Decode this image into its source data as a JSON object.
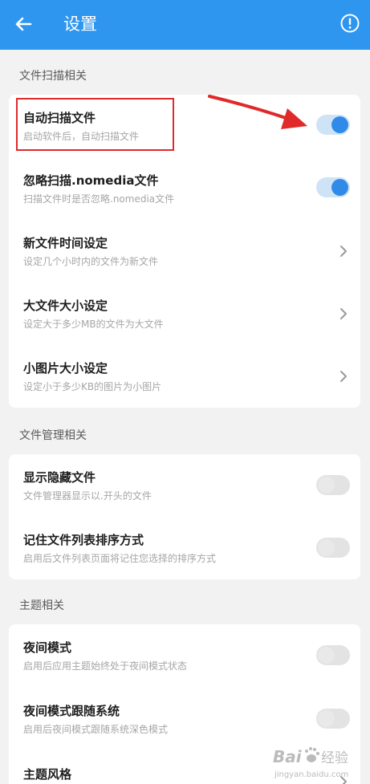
{
  "header": {
    "title": "设置",
    "back_icon": "arrow-left-icon",
    "info_icon": "exclamation-circle-icon"
  },
  "sections": [
    {
      "title": "文件扫描相关",
      "items": [
        {
          "label": "自动扫描文件",
          "sub": "启动软件后，自动扫描文件",
          "control": "toggle",
          "state": "on"
        },
        {
          "label": "忽略扫描.nomedia文件",
          "sub": "扫描文件时是否忽略.nomedia文件",
          "control": "toggle",
          "state": "on"
        },
        {
          "label": "新文件时间设定",
          "sub": "设定几个小时内的文件为新文件",
          "control": "chevron"
        },
        {
          "label": "大文件大小设定",
          "sub": "设定大于多少MB的文件为大文件",
          "control": "chevron"
        },
        {
          "label": "小图片大小设定",
          "sub": "设定小于多少KB的图片为小图片",
          "control": "chevron"
        }
      ]
    },
    {
      "title": "文件管理相关",
      "items": [
        {
          "label": "显示隐藏文件",
          "sub": "文件管理器显示以.开头的文件",
          "control": "toggle",
          "state": "off"
        },
        {
          "label": "记住文件列表排序方式",
          "sub": "启用后文件列表页面将记住您选择的排序方式",
          "control": "toggle",
          "state": "off"
        }
      ]
    },
    {
      "title": "主题相关",
      "items": [
        {
          "label": "夜间模式",
          "sub": "启用后应用主题始终处于夜间模式状态",
          "control": "toggle",
          "state": "off"
        },
        {
          "label": "夜间模式跟随系统",
          "sub": "启用后夜间模式跟随系统深色模式",
          "control": "toggle",
          "state": "off"
        },
        {
          "label": "主题风格",
          "control": "chevron"
        }
      ]
    }
  ],
  "annotation": {
    "highlight_color": "#e02a2a",
    "arrow_color": "#e02a2a"
  },
  "watermark": {
    "brand": "Bai",
    "suffix": "经验",
    "url": "jingyan.baidu.com"
  },
  "colors": {
    "header": "#2f96f0",
    "toggle_on_knob": "#2f8ae8",
    "toggle_on_track": "#cfe3f7",
    "toggle_off_track": "#e3e3e3",
    "background": "#f2f2f2"
  }
}
